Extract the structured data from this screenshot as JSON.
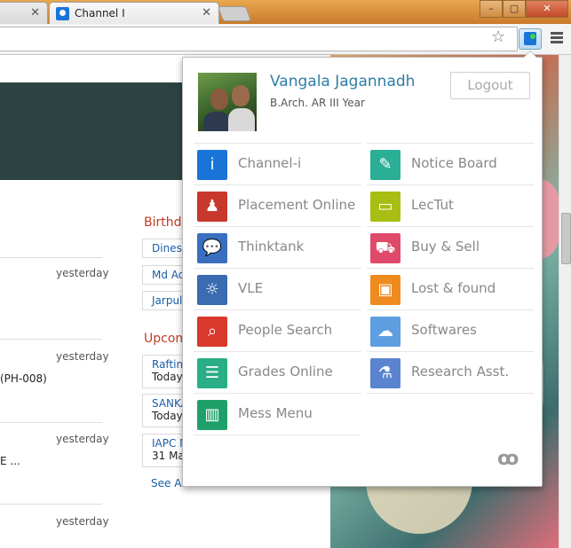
{
  "browser": {
    "tabs": [
      {
        "title": "",
        "close": "✕"
      },
      {
        "title": "Channel I",
        "close": "✕"
      }
    ],
    "window_controls": [
      "–",
      "▢",
      "✕"
    ],
    "star_icon": "☆"
  },
  "page": {
    "feed": [
      {
        "time": "yesterday",
        "text": ""
      },
      {
        "time": "yesterday",
        "text": "(PH-008)"
      },
      {
        "time": "yesterday",
        "text": "E ..."
      },
      {
        "time": "yesterday",
        "text": ""
      }
    ],
    "birthdays_title": "Birthda",
    "birthdays": [
      "Dinesh",
      "Md Aq",
      "Jarpul"
    ],
    "upcoming_title": "Upcom",
    "upcoming": [
      {
        "name": "Rafting",
        "date": "Today"
      },
      {
        "name": "SANKA",
        "date": "Today"
      },
      {
        "name": "IAPC M",
        "date": "31 Mar"
      }
    ],
    "see_all": "See Al"
  },
  "popup": {
    "user": {
      "name": "Vangala Jagannadh",
      "subtitle": "B.Arch. AR III Year"
    },
    "logout_label": "Logout",
    "left_items": [
      {
        "label": "Channel-i",
        "icon": "channel-i-icon",
        "color": "#1a74d8"
      },
      {
        "label": "Placement Online",
        "icon": "placement-icon",
        "color": "#c8382c"
      },
      {
        "label": "Thinktank",
        "icon": "chat-bubbles-icon",
        "color": "#3a6fc0"
      },
      {
        "label": "VLE",
        "icon": "lightbulb-icon",
        "color": "#3b6bb0"
      },
      {
        "label": "People Search",
        "icon": "people-search-icon",
        "color": "#d9382c"
      },
      {
        "label": "Grades Online",
        "icon": "grades-icon",
        "color": "#2aae88"
      },
      {
        "label": "Mess Menu",
        "icon": "drink-icon",
        "color": "#1fa06a"
      }
    ],
    "right_items": [
      {
        "label": "Notice Board",
        "icon": "pin-icon",
        "color": "#2aae96"
      },
      {
        "label": "LecTut",
        "icon": "book-icon",
        "color": "#a8be12"
      },
      {
        "label": "Buy & Sell",
        "icon": "cart-icon",
        "color": "#e04a6a"
      },
      {
        "label": "Lost & found",
        "icon": "box-icon",
        "color": "#ee8a1e"
      },
      {
        "label": "Softwares",
        "icon": "download-cloud-icon",
        "color": "#5e9ee0"
      },
      {
        "label": "Research Asst.",
        "icon": "microscope-icon",
        "color": "#5b84d0"
      }
    ],
    "brand_mark": "ꝏ"
  }
}
